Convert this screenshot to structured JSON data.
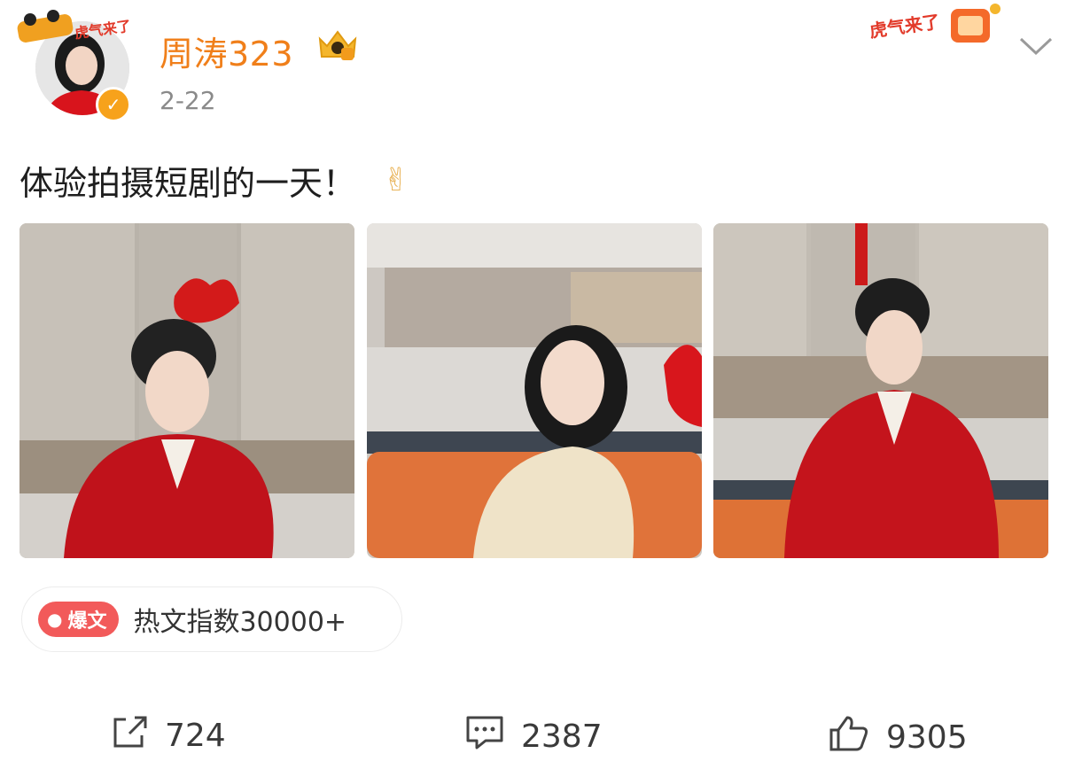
{
  "header": {
    "username": "周涛323",
    "date": "2-22",
    "avatar_verified_icon": "verified-v-icon",
    "vip_icon": "crown-badge-icon",
    "sticker_text": "虎气来了",
    "menu_icon": "chevron-down-icon"
  },
  "post": {
    "text": "体验拍摄短剧的一天！",
    "emoji": "✌",
    "images": [
      {
        "name": "photo-1"
      },
      {
        "name": "photo-2"
      },
      {
        "name": "photo-3"
      }
    ]
  },
  "hot": {
    "tag_label": "爆文",
    "text": "热文指数30000+"
  },
  "actions": {
    "share_count": "724",
    "comment_count": "2387",
    "like_count": "9305"
  },
  "colors": {
    "username": "#f07f1a",
    "hot_tag": "#f25a5a",
    "coat_red": "#c0121b"
  }
}
